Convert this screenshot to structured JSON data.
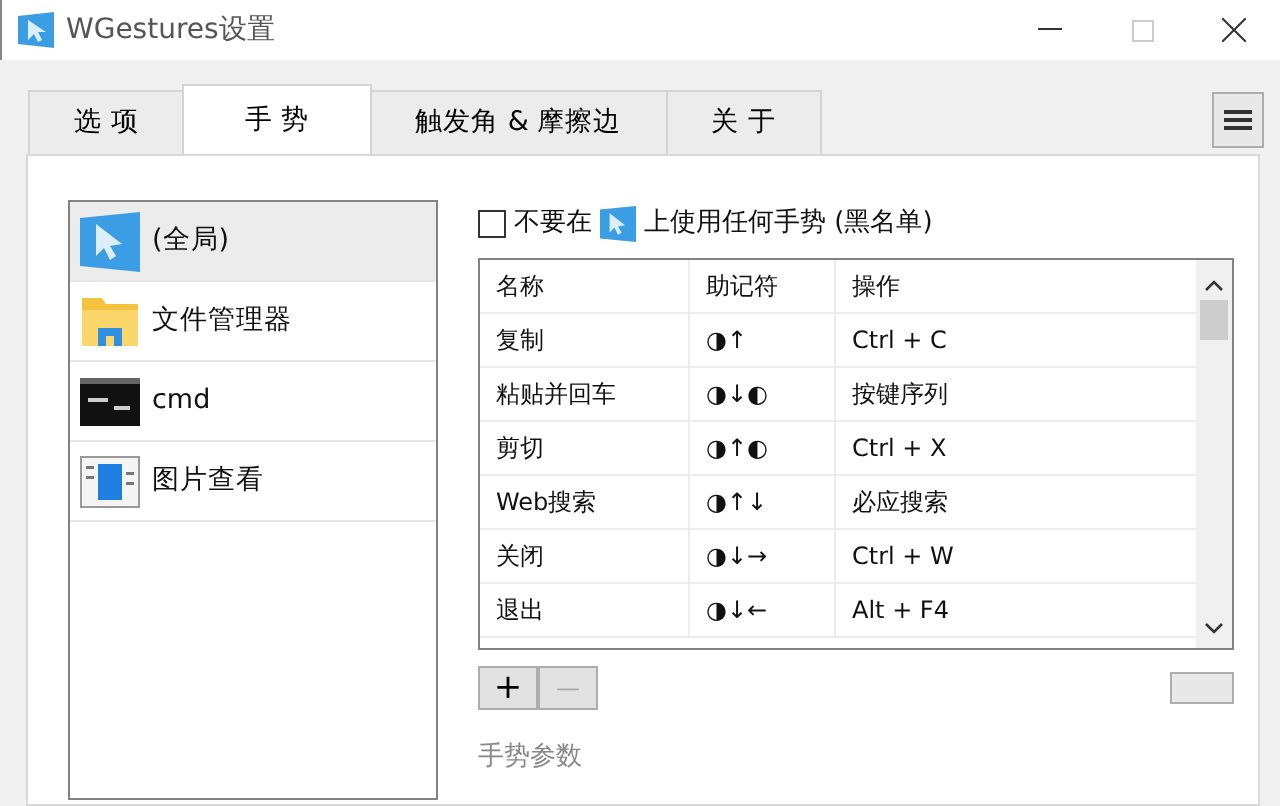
{
  "window": {
    "title": "WGestures设置"
  },
  "tabs": [
    {
      "label": "选 项",
      "selected": false
    },
    {
      "label": "手 势",
      "selected": true
    },
    {
      "label": "触发角 & 摩擦边",
      "selected": false
    },
    {
      "label": "关 于",
      "selected": false
    }
  ],
  "apps": [
    {
      "name": "(全局)",
      "kind": "global",
      "selected": true
    },
    {
      "name": "文件管理器",
      "kind": "folder",
      "selected": false
    },
    {
      "name": "cmd",
      "kind": "console",
      "selected": false
    },
    {
      "name": "图片查看",
      "kind": "viewer",
      "selected": false
    }
  ],
  "blacklist": {
    "checked": false,
    "label_before": "不要在",
    "label_after": "上使用任何手势 (黑名单)"
  },
  "gestures": {
    "columns": [
      "名称",
      "助记符",
      "操作"
    ],
    "rows": [
      [
        "复制",
        "◑↑",
        "Ctrl + C"
      ],
      [
        "粘贴并回车",
        "◑↓◐",
        "按键序列"
      ],
      [
        "剪切",
        "◑↑◐",
        "Ctrl + X"
      ],
      [
        "Web搜索",
        "◑↑↓",
        "必应搜索"
      ],
      [
        "关闭",
        "◑↓→",
        "Ctrl + W"
      ],
      [
        "退出",
        "◑↓←",
        "Alt + F4"
      ]
    ]
  },
  "buttons": [
    {
      "label": "+",
      "disabled": false
    },
    {
      "label": "—",
      "disabled": true
    }
  ],
  "params_group": {
    "title": "手势参数"
  }
}
